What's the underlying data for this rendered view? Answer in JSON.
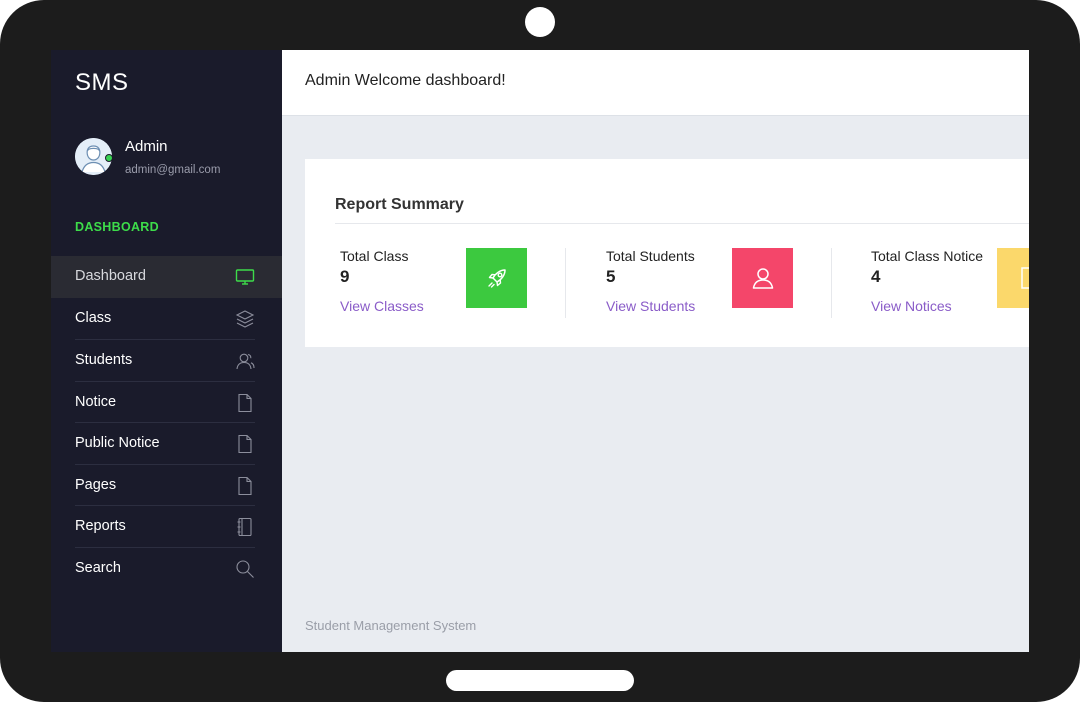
{
  "app": {
    "brand": "SMS"
  },
  "user": {
    "name": "Admin",
    "email": "admin@gmail.com"
  },
  "sidebar": {
    "section_label": "DASHBOARD",
    "items": [
      {
        "label": "Dashboard",
        "icon": "monitor-icon",
        "active": true
      },
      {
        "label": "Class",
        "icon": "layers-icon"
      },
      {
        "label": "Students",
        "icon": "users-icon"
      },
      {
        "label": "Notice",
        "icon": "document-icon"
      },
      {
        "label": "Public Notice",
        "icon": "document-icon"
      },
      {
        "label": "Pages",
        "icon": "document-icon"
      },
      {
        "label": "Reports",
        "icon": "notebook-icon"
      },
      {
        "label": "Search",
        "icon": "search-icon"
      }
    ]
  },
  "header": {
    "title": "Admin Welcome dashboard!"
  },
  "report": {
    "title": "Report Summary",
    "stats": [
      {
        "label": "Total Class",
        "value": "9",
        "link": "View Classes",
        "icon": "rocket-icon",
        "color": "#3cc93f"
      },
      {
        "label": "Total Students",
        "value": "5",
        "link": "View Students",
        "icon": "user-icon",
        "color": "#f4466a"
      },
      {
        "label": "Total Class Notice",
        "value": "4",
        "link": "View Notices",
        "icon": "document-icon",
        "color": "#fbd86b"
      }
    ]
  },
  "footer": {
    "text": "Student Management System"
  },
  "colors": {
    "sidebar_bg": "#1a1b2b",
    "accent_green": "#3ddc4a",
    "link_purple": "#8a5cc8"
  }
}
